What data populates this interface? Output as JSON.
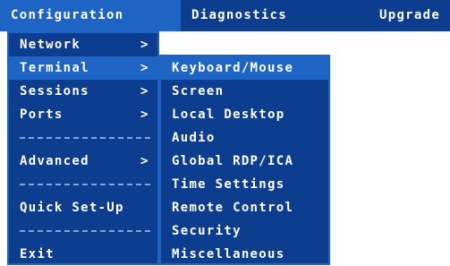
{
  "topbar": {
    "items": [
      "Configuration",
      "Diagnostics",
      "Upgrade"
    ]
  },
  "main_menu": {
    "network": "Network",
    "terminal": "Terminal",
    "sessions": "Sessions",
    "ports": "Ports",
    "advanced": "Advanced",
    "quick_setup": "Quick Set-Up",
    "exit": "Exit",
    "arrow": ">"
  },
  "sub_menu": {
    "items": [
      "Keyboard/Mouse",
      "Screen",
      "Local Desktop",
      "Audio",
      "Global RDP/ICA",
      "Time Settings",
      "Remote Control",
      "Security",
      "Miscellaneous"
    ]
  },
  "colors": {
    "menu_background": "#0d3d8f",
    "highlight": "#1e64c4",
    "text": "#ffffff",
    "page_background": "#ffffff"
  }
}
